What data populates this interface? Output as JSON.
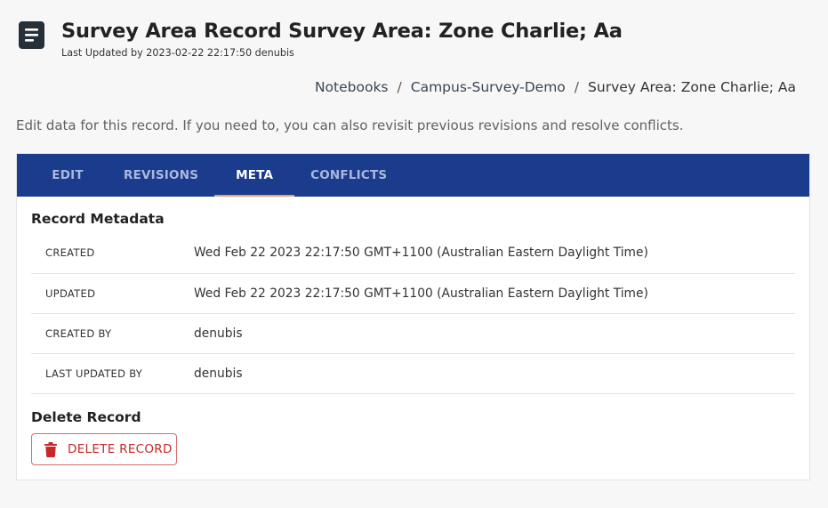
{
  "header": {
    "icon": "document-icon",
    "title": "Survey Area Record Survey Area: Zone Charlie; Aa",
    "last_updated": "Last Updated by 2023-02-22 22:17:50 denubis"
  },
  "breadcrumb": {
    "items": [
      "Notebooks",
      "Campus-Survey-Demo",
      "Survey Area: Zone Charlie; Aa"
    ],
    "separator": "/"
  },
  "intro": "Edit data for this record. If you need to, you can also revisit previous revisions and resolve conflicts.",
  "tabs": [
    {
      "label": "EDIT",
      "active": false
    },
    {
      "label": "REVISIONS",
      "active": false
    },
    {
      "label": "META",
      "active": true
    },
    {
      "label": "CONFLICTS",
      "active": false
    }
  ],
  "metadata": {
    "title": "Record Metadata",
    "rows": [
      {
        "label": "CREATED",
        "value": "Wed Feb 22 2023 22:17:50 GMT+1100 (Australian Eastern Daylight Time)"
      },
      {
        "label": "UPDATED",
        "value": "Wed Feb 22 2023 22:17:50 GMT+1100 (Australian Eastern Daylight Time)"
      },
      {
        "label": "CREATED BY",
        "value": "denubis"
      },
      {
        "label": "LAST UPDATED BY",
        "value": "denubis"
      }
    ]
  },
  "delete": {
    "title": "Delete Record",
    "button_label": "DELETE RECORD",
    "icon": "trash-icon"
  },
  "colors": {
    "tab_bar": "#1b3b8c",
    "tab_indicator": "#d5a86a",
    "danger": "#c62828"
  }
}
